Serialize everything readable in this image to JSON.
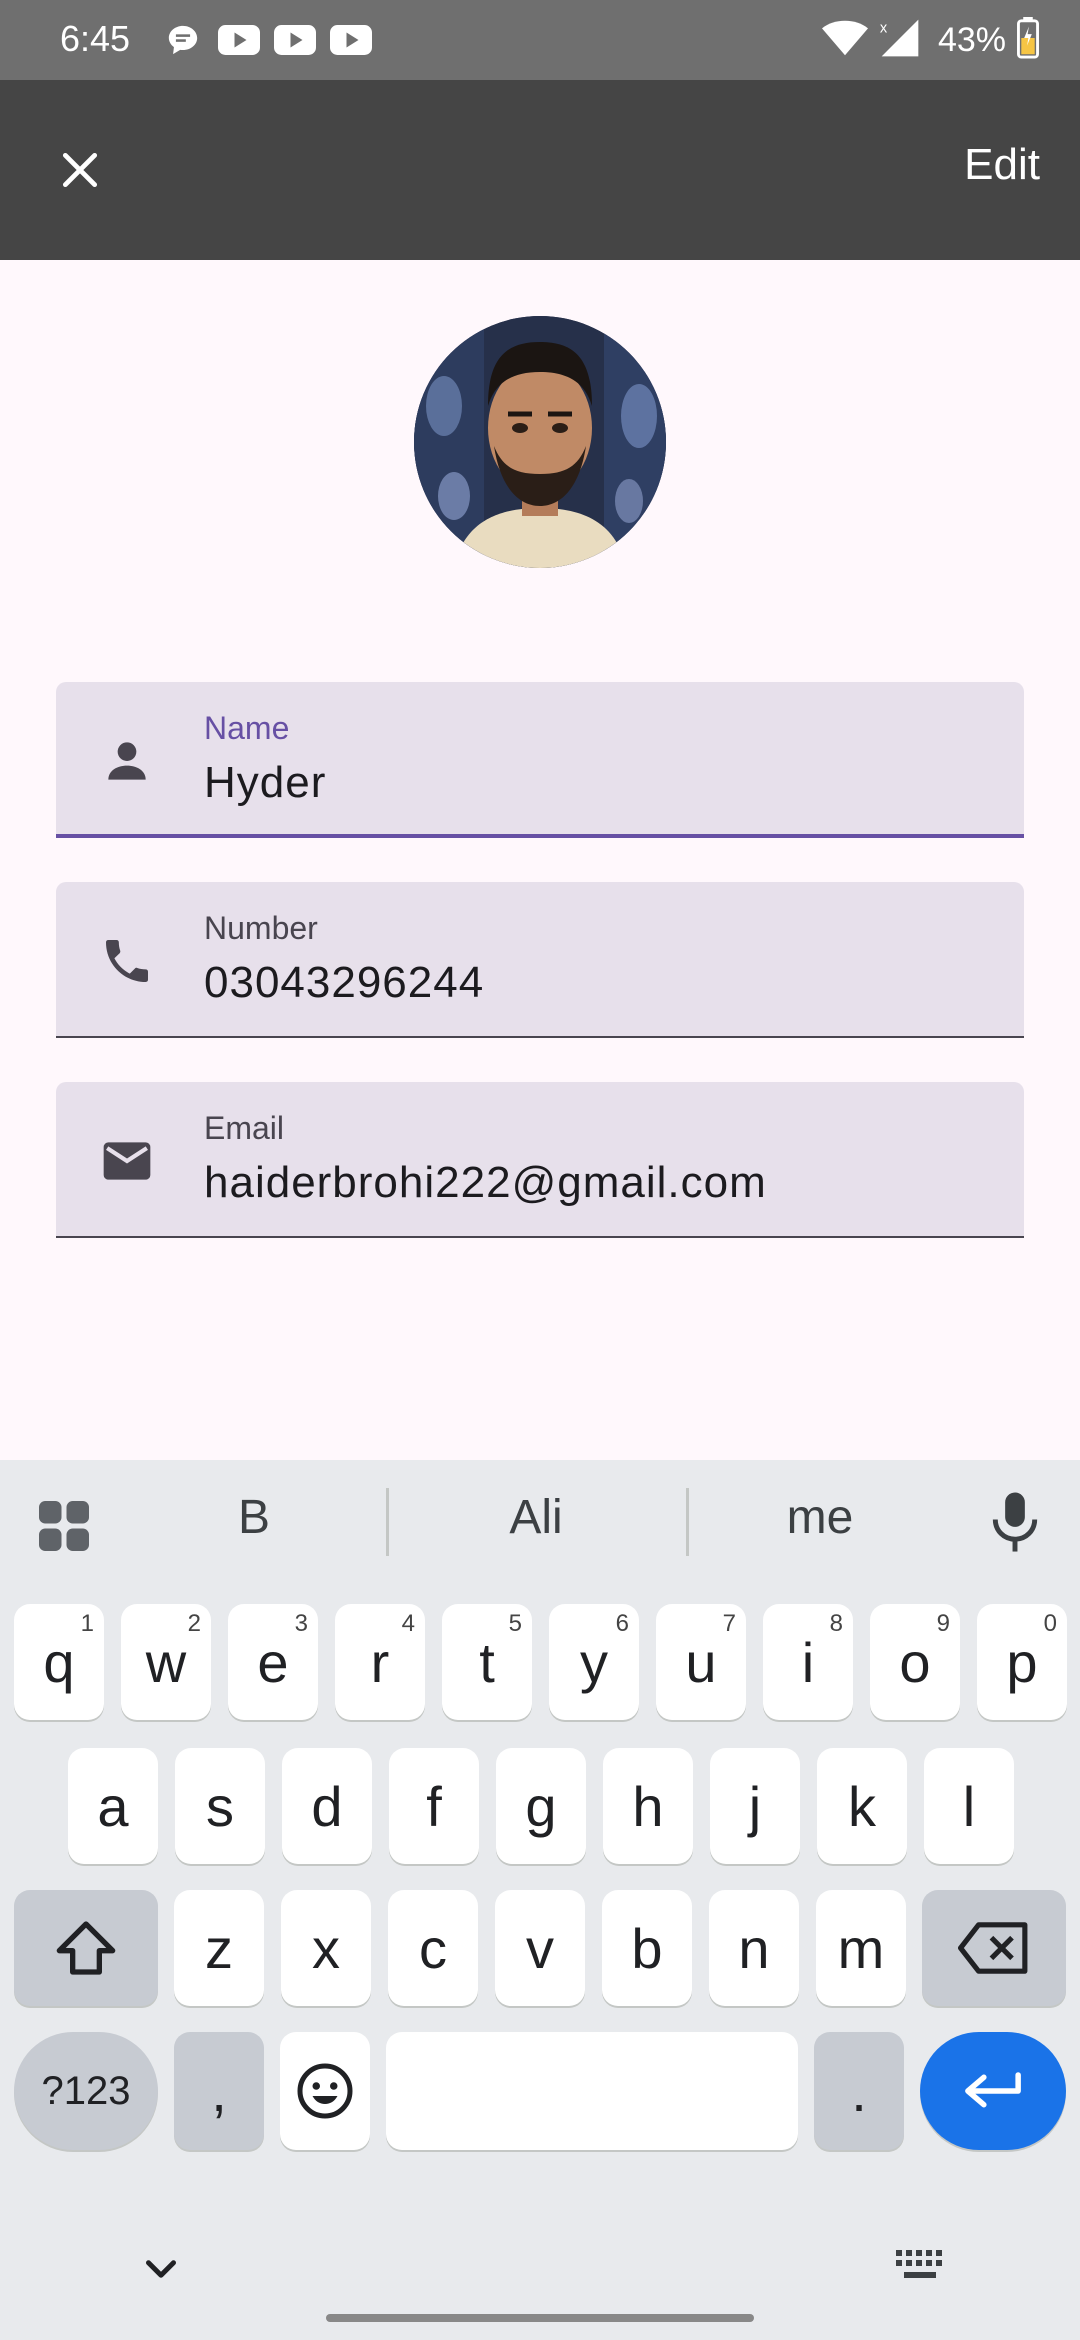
{
  "status_bar": {
    "time": "6:45",
    "battery": "43%",
    "notification_icons": [
      "chat-bubble-icon",
      "youtube-icon",
      "youtube-icon",
      "youtube-icon"
    ]
  },
  "app_bar": {
    "close_icon": "close-icon",
    "edit_label": "Edit",
    "background": "#454545"
  },
  "contact": {
    "fields": [
      {
        "label": "Name",
        "value": "Hyder",
        "icon": "person-icon",
        "focused": true
      },
      {
        "label": "Number",
        "value": "03043296244",
        "icon": "phone-icon",
        "focused": false
      },
      {
        "label": "Email",
        "value": "haiderbrohi222@gmail.com",
        "icon": "email-icon",
        "focused": false
      }
    ]
  },
  "keyboard": {
    "suggestions": [
      "B",
      "Ali",
      "me"
    ],
    "row1": [
      "q",
      "w",
      "e",
      "r",
      "t",
      "y",
      "u",
      "i",
      "o",
      "p"
    ],
    "row1_hints": [
      "1",
      "2",
      "3",
      "4",
      "5",
      "6",
      "7",
      "8",
      "9",
      "0"
    ],
    "row2": [
      "a",
      "s",
      "d",
      "f",
      "g",
      "h",
      "j",
      "k",
      "l"
    ],
    "row3": [
      "z",
      "x",
      "c",
      "v",
      "b",
      "n",
      "m"
    ],
    "symbols_label": "?123",
    "comma": ",",
    "period": ".",
    "accent": "#1A73E8"
  },
  "colors": {
    "field_bg": "#E7E0EB",
    "focus": "#6750A4",
    "page_bg": "#FFF8FC"
  }
}
